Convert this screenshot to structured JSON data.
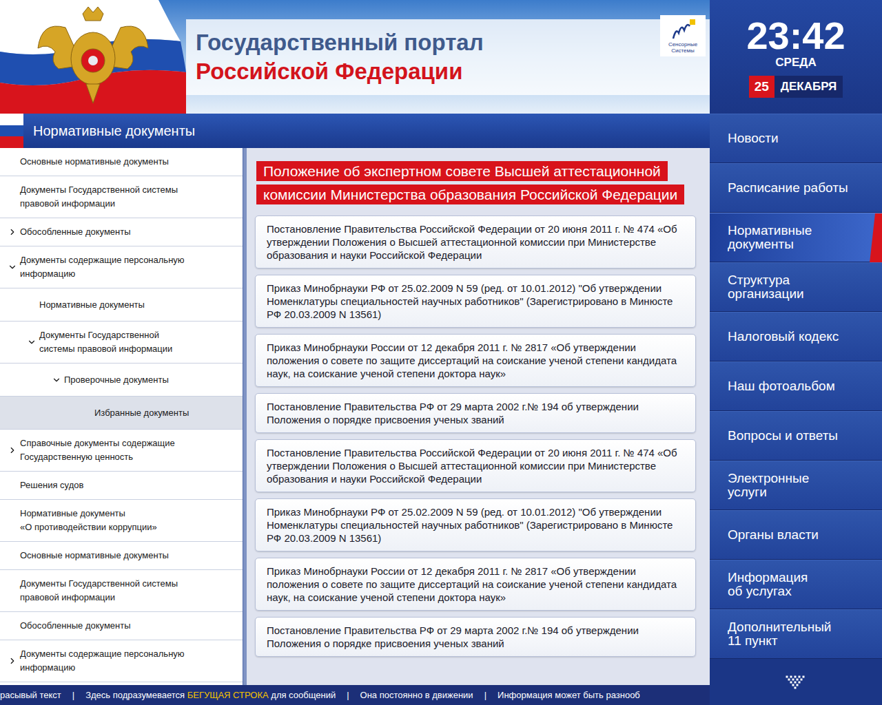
{
  "header": {
    "title_line1": "Государственный портал",
    "title_line2": "Российской Федерации",
    "logo_text": "Сенсорные\nСистемы"
  },
  "clock": {
    "time": "23:42",
    "weekday": "СРЕДА",
    "day": "25",
    "month": "ДЕКАБРЯ"
  },
  "section": {
    "title": "Нормативные документы"
  },
  "sidebar": {
    "items": [
      {
        "label": "Основные нормативные документы",
        "level": 0,
        "expandable": false,
        "expanded": false,
        "selected": false
      },
      {
        "label": "Документы Государственной системы\nправовой информации",
        "level": 0,
        "expandable": false,
        "expanded": false,
        "selected": false
      },
      {
        "label": "Обособленные документы",
        "level": 0,
        "expandable": true,
        "expanded": false,
        "selected": false
      },
      {
        "label": "Документы содержащие персональную\nинформацию",
        "level": 0,
        "expandable": true,
        "expanded": true,
        "selected": false
      },
      {
        "label": "Нормативные документы",
        "level": 1,
        "expandable": false,
        "expanded": false,
        "selected": false
      },
      {
        "label": "Документы Государственной\nсистемы правовой информации",
        "level": 1,
        "expandable": true,
        "expanded": true,
        "selected": false
      },
      {
        "label": "Проверочные документы",
        "level": 2,
        "expandable": true,
        "expanded": true,
        "selected": false
      },
      {
        "label": "Избранные документы",
        "level": 3,
        "expandable": false,
        "expanded": false,
        "selected": true
      },
      {
        "label": "Справочные документы содержащие\nГосударственную ценность",
        "level": 0,
        "expandable": true,
        "expanded": false,
        "selected": false
      },
      {
        "label": "Решения судов",
        "level": 0,
        "expandable": false,
        "expanded": false,
        "selected": false
      },
      {
        "label": "Нормативные документы\n«О противодействии коррупции»",
        "level": 0,
        "expandable": false,
        "expanded": false,
        "selected": false
      },
      {
        "label": "Основные нормативные документы",
        "level": 0,
        "expandable": false,
        "expanded": false,
        "selected": false
      },
      {
        "label": "Документы Государственной системы\nправовой информации",
        "level": 0,
        "expandable": false,
        "expanded": false,
        "selected": false
      },
      {
        "label": "Обособленные документы",
        "level": 0,
        "expandable": false,
        "expanded": false,
        "selected": false
      },
      {
        "label": "Документы содержащие персональную\nинформацию",
        "level": 0,
        "expandable": true,
        "expanded": false,
        "selected": false
      }
    ]
  },
  "content": {
    "title": "Положение об экспертном совете Высшей аттестационной\nкомиссии Министерства образования Российской Федерации",
    "documents": [
      "Постановление Правительства Российской Федерации от 20 июня 2011 г. № 474 «Об утверждении Положения о Высшей аттестационной комиссии при Министерстве образования и науки Российской Федерации",
      "Приказ Минобрнауки РФ от 25.02.2009 N 59 (ред. от 10.01.2012) \"Об утверждении Номенклатуры специальностей научных работников\" (Зарегистрировано в Минюсте РФ 20.03.2009 N 13561)",
      "Приказ Минобрнауки России от 12 декабря 2011 г. № 2817 «Об утверждении положения о совете по защите диссертаций на соискание ученой степени кандидата наук, на соискание ученой степени доктора наук»",
      "Постановление Правительства РФ от 29 марта 2002 г.№ 194 об утверждении Положения о порядке присвоения ученых званий",
      "Постановление Правительства Российской Федерации от 20 июня 2011 г. № 474 «Об утверждении Положения о Высшей аттестационной комиссии при Министерстве образования и науки Российской Федерации",
      "Приказ Минобрнауки РФ от 25.02.2009 N 59 (ред. от 10.01.2012) \"Об утверждении Номенклатуры специальностей научных работников\" (Зарегистрировано в Минюсте РФ 20.03.2009 N 13561)",
      "Приказ Минобрнауки России от 12 декабря 2011 г. № 2817 «Об утверждении положения о совете по защите диссертаций на соискание ученой степени кандидата наук, на соискание ученой степени доктора наук»",
      "Постановление Правительства РФ от 29 марта 2002 г.№ 194 об утверждении Положения о порядке присвоения ученых званий"
    ]
  },
  "menu": {
    "items": [
      {
        "label": "Новости",
        "selected": false
      },
      {
        "label": "Расписание работы",
        "selected": false
      },
      {
        "label": "Нормативные\nдокументы",
        "selected": true
      },
      {
        "label": "Структура\nорганизации",
        "selected": false
      },
      {
        "label": "Налоговый кодекс",
        "selected": false
      },
      {
        "label": "Наш фотоальбом",
        "selected": false
      },
      {
        "label": "Вопросы и ответы",
        "selected": false
      },
      {
        "label": "Электронные\nуслуги",
        "selected": false
      },
      {
        "label": "Органы власти",
        "selected": false
      },
      {
        "label": "Информация\nоб услугах",
        "selected": false
      },
      {
        "label": "Дополнительный\n11 пункт",
        "selected": false
      }
    ]
  },
  "ticker": {
    "separator": "|",
    "segments": [
      {
        "parts": [
          {
            "text": "расывый текст",
            "highlight": false
          }
        ]
      },
      {
        "parts": [
          {
            "text": "Здесь подразумевается ",
            "highlight": false
          },
          {
            "text": "БЕГУЩАЯ СТРОКА",
            "highlight": true
          },
          {
            "text": " для сообщений",
            "highlight": false
          }
        ]
      },
      {
        "parts": [
          {
            "text": "Она постоянно в движении",
            "highlight": false
          }
        ]
      },
      {
        "parts": [
          {
            "text": "Информация может быть разнооб",
            "highlight": false
          }
        ]
      }
    ]
  }
}
